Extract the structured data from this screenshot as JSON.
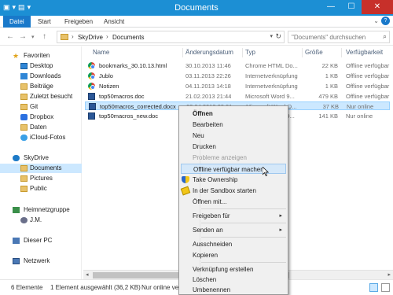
{
  "window": {
    "title": "Documents",
    "controls": {
      "minimize": "—",
      "maximize": "☐",
      "close": "✕"
    }
  },
  "quick_access": {
    "qat_glyphs": [
      "▣",
      "▾",
      "▤",
      "▾"
    ]
  },
  "ribbon": {
    "tabs": [
      {
        "label": "Datei"
      },
      {
        "label": "Start"
      },
      {
        "label": "Freigeben"
      },
      {
        "label": "Ansicht"
      }
    ],
    "expand_glyph": "⌄",
    "help_glyph": "?"
  },
  "navigation": {
    "back": "←",
    "forward": "→",
    "recent": "▾",
    "up": "↑",
    "breadcrumb": [
      "SkyDrive",
      "Documents"
    ],
    "breadcrumb_sep": "›",
    "dropdown": "▾",
    "refresh": "↻",
    "search_placeholder": "\"Documents\" durchsuchen",
    "search_glyph": "⌕"
  },
  "sidebar": {
    "favorites_label": "Favoriten",
    "favorites": [
      {
        "label": "Desktop",
        "icon": "desktop-icon"
      },
      {
        "label": "Downloads",
        "icon": "downloads-icon"
      },
      {
        "label": "Beiträge",
        "icon": "folder-icon"
      },
      {
        "label": "Zuletzt besucht",
        "icon": "recent-places-icon"
      },
      {
        "label": "Git",
        "icon": "folder-icon"
      },
      {
        "label": "Dropbox",
        "icon": "dropbox-icon"
      },
      {
        "label": "Daten",
        "icon": "folder-icon"
      },
      {
        "label": "iCloud-Fotos",
        "icon": "icloud-icon"
      }
    ],
    "skydrive_label": "SkyDrive",
    "skydrive": [
      {
        "label": "Documents",
        "icon": "folder-icon"
      },
      {
        "label": "Pictures",
        "icon": "folder-icon"
      },
      {
        "label": "Public",
        "icon": "folder-icon"
      }
    ],
    "homegroup_label": "Heimnetzgruppe",
    "homegroup_user": "J.M.",
    "pc_label": "Dieser PC",
    "network_label": "Netzwerk"
  },
  "file_list": {
    "columns": {
      "name": "Name",
      "date": "Änderungsdatum",
      "type": "Typ",
      "size": "Größe",
      "availability": "Verfügbarkeit"
    },
    "rows": [
      {
        "name": "bookmarks_30.10.13.html",
        "date": "30.10.2013 11:46",
        "type": "Chrome HTML Do...",
        "size": "22 KB",
        "availability": "Offline verfügbar",
        "icon": "chrome-icon"
      },
      {
        "name": "Jublo",
        "date": "03.11.2013 22:26",
        "type": "Internetverknüpfung",
        "size": "1 KB",
        "availability": "Offline verfügbar",
        "icon": "chrome-icon"
      },
      {
        "name": "Notizen",
        "date": "04.11.2013 14:18",
        "type": "Internetverknüpfung",
        "size": "1 KB",
        "availability": "Offline verfügbar",
        "icon": "chrome-icon"
      },
      {
        "name": "top50macros.doc",
        "date": "21.02.2013 21:44",
        "type": "Microsoft Word 9...",
        "size": "479 KB",
        "availability": "Offline verfügbar",
        "icon": "word-icon"
      },
      {
        "name": "top50macros_corrected.docx",
        "date": "03.04.2013 23:01",
        "type": "Microsoft Word-D...",
        "size": "37 KB",
        "availability": "Nur online",
        "icon": "word-icon",
        "selected": true
      },
      {
        "name": "top50macros_new.doc",
        "date": "",
        "type": "Microsoft Word 9...",
        "size": "141 KB",
        "availability": "Nur online",
        "icon": "word-icon"
      }
    ]
  },
  "context_menu": {
    "items": [
      {
        "label": "Öffnen"
      },
      {
        "label": "Bearbeiten"
      },
      {
        "label": "Neu"
      },
      {
        "label": "Drucken"
      },
      {
        "label": "Probleme anzeigen"
      },
      {
        "label": "Offline verfügbar machen"
      },
      {
        "label": "Take Ownership"
      },
      {
        "label": "In der Sandbox starten"
      },
      {
        "label": "Öffnen mit..."
      },
      {
        "label": "Freigeben für"
      },
      {
        "label": "Senden an"
      },
      {
        "label": "Ausschneiden"
      },
      {
        "label": "Kopieren"
      },
      {
        "label": "Verknüpfung erstellen"
      },
      {
        "label": "Löschen"
      },
      {
        "label": "Umbenennen"
      }
    ],
    "submenu_arrow": "▸"
  },
  "statusbar": {
    "item_count": "6 Elemente",
    "selection": "1 Element ausgewählt (36,2 KB)",
    "availability": "Nur online verf"
  },
  "scrollbar": {
    "left": "◂",
    "right": "▸"
  },
  "colors": {
    "title_bar": "#1c8fd4",
    "file_tab": "#1979ca",
    "selection": "#cce8ff",
    "close_button": "#c7302a"
  }
}
